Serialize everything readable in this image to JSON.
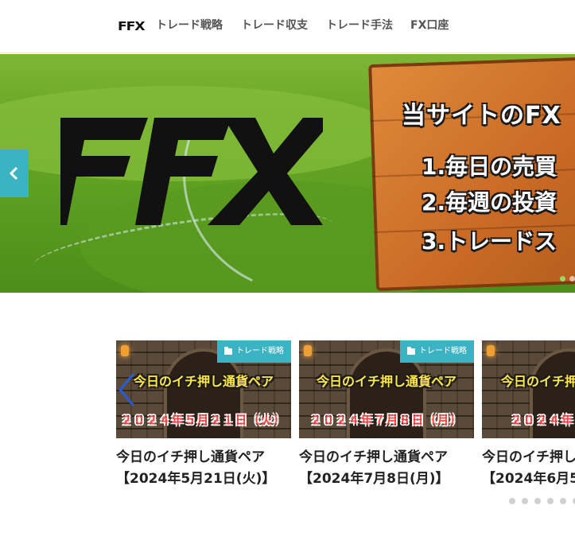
{
  "header": {
    "logo_text": "FFX",
    "nav": [
      {
        "label": "トレード戦略"
      },
      {
        "label": "トレード収支"
      },
      {
        "label": "トレード手法"
      },
      {
        "label": "FX口座"
      }
    ]
  },
  "hero": {
    "big_logo": "FFX",
    "board_title": "当サイトのFX",
    "board_items": [
      "1.毎日の売買",
      "2.毎週の投資",
      "3.トレードス"
    ],
    "prev_icon": "chevron-left-icon",
    "dots_count": 2,
    "colors": {
      "accent": "#3bb3c3",
      "grass": "#6aa826",
      "board": "#d27530"
    }
  },
  "cards": [
    {
      "category": "トレード戦略",
      "thumb_line1": "今日のイチ押し通貨ペア",
      "thumb_line2": "２０２４年５月２１日（火）",
      "title_line1": "今日のイチ押し通貨ペア",
      "title_line2": "【2024年5月21日(火)】"
    },
    {
      "category": "トレード戦略",
      "thumb_line1": "今日のイチ押し通貨ペア",
      "thumb_line2": "２０２４年７月８日（月）",
      "title_line1": "今日のイチ押し通貨ペア",
      "title_line2": "【2024年7月8日(月)】"
    },
    {
      "category": "",
      "thumb_line1": "今日のイチ押",
      "thumb_line2": "２０２４年６",
      "title_line1": "今日のイチ押し",
      "title_line2": "【2024年6月5"
    }
  ],
  "carousel": {
    "prev_icon": "chevron-left-icon",
    "dots_count": 6
  }
}
